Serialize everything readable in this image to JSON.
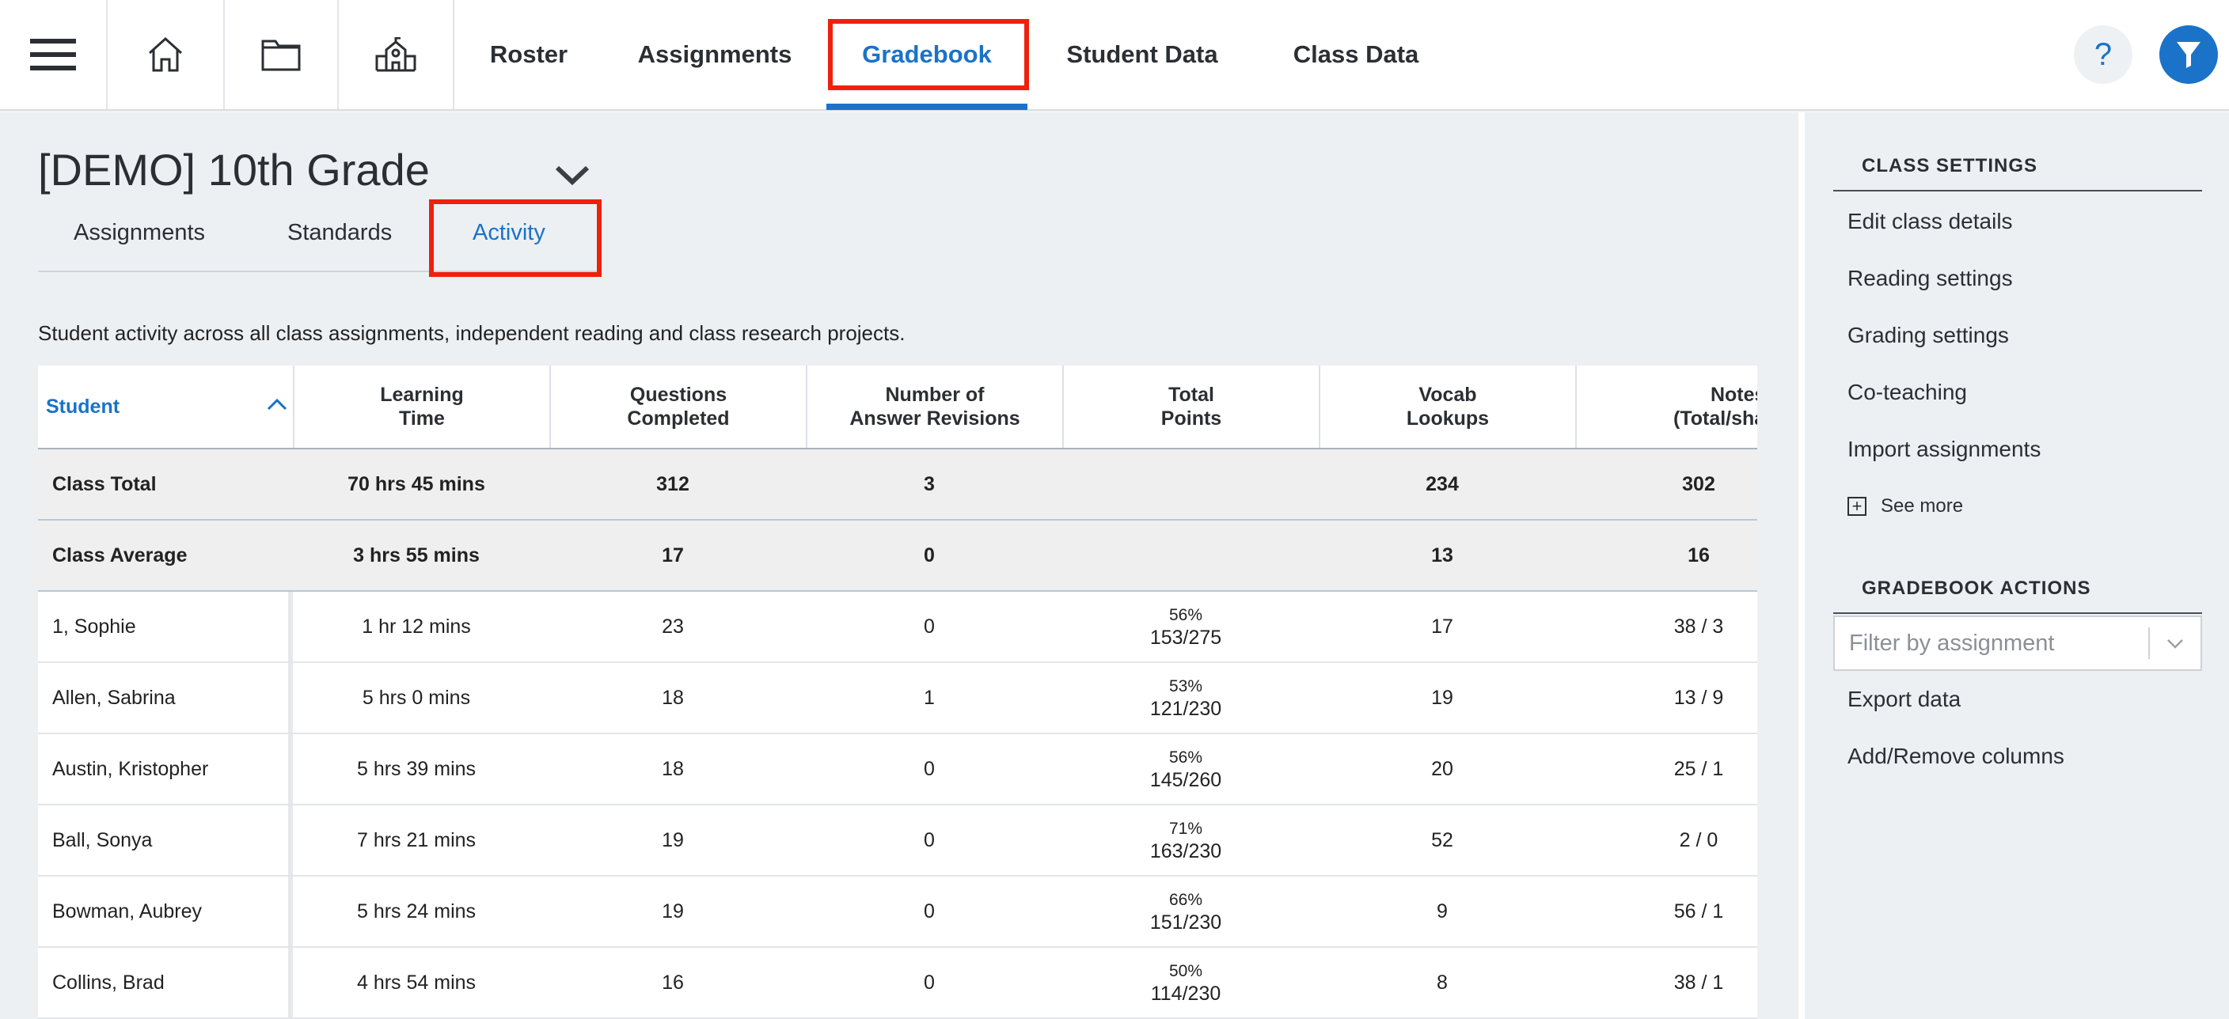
{
  "nav": {
    "links": [
      "Roster",
      "Assignments",
      "Gradebook",
      "Student Data",
      "Class Data"
    ],
    "active": "Gradebook",
    "help_label": "?"
  },
  "class": {
    "title": "[DEMO] 10th Grade",
    "subtabs": [
      "Assignments",
      "Standards",
      "Activity"
    ],
    "active_subtab": "Activity",
    "description": "Student activity across all class assignments, independent reading and class research projects."
  },
  "table": {
    "headers": {
      "student": "Student",
      "learning_time": [
        "Learning",
        "Time"
      ],
      "questions": [
        "Questions",
        "Completed"
      ],
      "revisions": [
        "Number of",
        "Answer Revisions"
      ],
      "points": [
        "Total",
        "Points"
      ],
      "vocab": [
        "Vocab",
        "Lookups"
      ],
      "notes": [
        "Notes",
        "(Total/shared)"
      ]
    },
    "summary": [
      {
        "name": "Class Total",
        "time": "70 hrs 45 mins",
        "questions": "312",
        "revisions": "3",
        "pct": "",
        "points": "",
        "vocab": "234",
        "notes": "302"
      },
      {
        "name": "Class Average",
        "time": "3 hrs 55 mins",
        "questions": "17",
        "revisions": "0",
        "pct": "",
        "points": "",
        "vocab": "13",
        "notes": "16"
      }
    ],
    "rows": [
      {
        "name": "1, Sophie",
        "time": "1 hr 12 mins",
        "questions": "23",
        "revisions": "0",
        "pct": "56%",
        "points": "153/275",
        "vocab": "17",
        "notes": "38 / 3"
      },
      {
        "name": "Allen, Sabrina",
        "time": "5 hrs 0 mins",
        "questions": "18",
        "revisions": "1",
        "pct": "53%",
        "points": "121/230",
        "vocab": "19",
        "notes": "13 / 9"
      },
      {
        "name": "Austin, Kristopher",
        "time": "5 hrs 39 mins",
        "questions": "18",
        "revisions": "0",
        "pct": "56%",
        "points": "145/260",
        "vocab": "20",
        "notes": "25 / 1"
      },
      {
        "name": "Ball, Sonya",
        "time": "7 hrs 21 mins",
        "questions": "19",
        "revisions": "0",
        "pct": "71%",
        "points": "163/230",
        "vocab": "52",
        "notes": "2 / 0"
      },
      {
        "name": "Bowman, Aubrey",
        "time": "5 hrs 24 mins",
        "questions": "19",
        "revisions": "0",
        "pct": "66%",
        "points": "151/230",
        "vocab": "9",
        "notes": "56 / 1"
      },
      {
        "name": "Collins, Brad",
        "time": "4 hrs 54 mins",
        "questions": "16",
        "revisions": "0",
        "pct": "50%",
        "points": "114/230",
        "vocab": "8",
        "notes": "38 / 1"
      }
    ]
  },
  "sidebar": {
    "class_settings": {
      "heading": "CLASS SETTINGS",
      "items": [
        "Edit class details",
        "Reading settings",
        "Grading settings",
        "Co-teaching",
        "Import assignments"
      ],
      "see_more": "See more"
    },
    "gradebook_actions": {
      "heading": "GRADEBOOK ACTIONS",
      "filter_placeholder": "Filter by assignment",
      "items": [
        "Export data",
        "Add/Remove columns"
      ]
    }
  },
  "colors": {
    "accent": "#1a73c8",
    "highlight": "#f0200c",
    "background": "#edf0f3"
  }
}
